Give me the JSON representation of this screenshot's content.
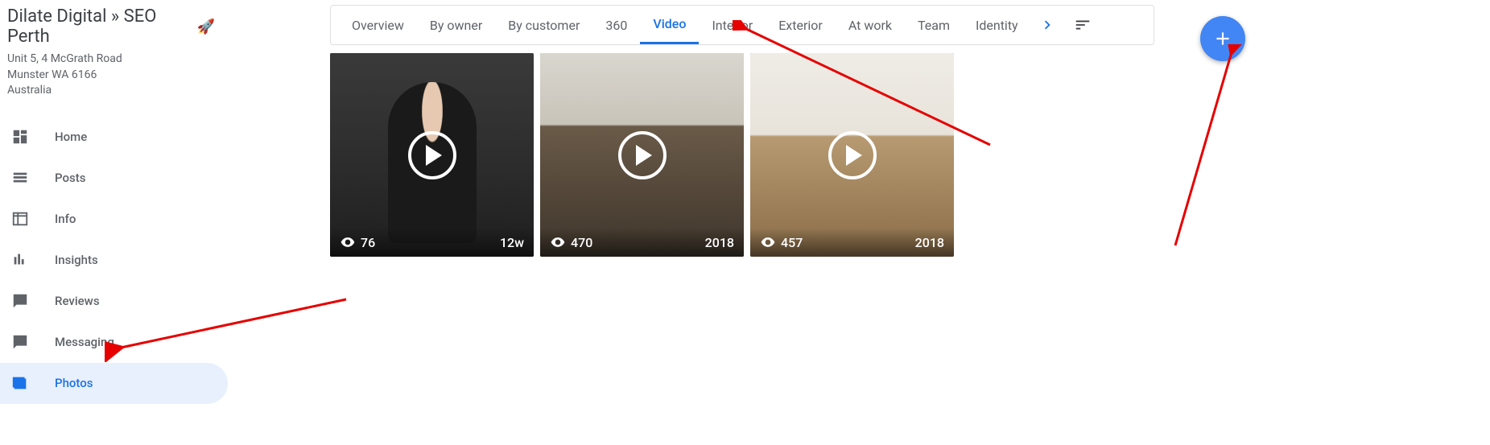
{
  "business": {
    "name": "Dilate Digital » SEO Perth",
    "rocket": "🚀",
    "address1": "Unit 5, 4 McGrath Road",
    "address2": "Munster WA 6166",
    "country": "Australia"
  },
  "sidebar": {
    "items": [
      {
        "label": "Home"
      },
      {
        "label": "Posts"
      },
      {
        "label": "Info"
      },
      {
        "label": "Insights"
      },
      {
        "label": "Reviews"
      },
      {
        "label": "Messaging"
      },
      {
        "label": "Photos"
      }
    ]
  },
  "tabs": {
    "items": [
      {
        "label": "Overview"
      },
      {
        "label": "By owner"
      },
      {
        "label": "By customer"
      },
      {
        "label": "360"
      },
      {
        "label": "Video"
      },
      {
        "label": "Interior"
      },
      {
        "label": "Exterior"
      },
      {
        "label": "At work"
      },
      {
        "label": "Team"
      },
      {
        "label": "Identity"
      }
    ],
    "active": "Video"
  },
  "videos": [
    {
      "views": "76",
      "date": "12w"
    },
    {
      "views": "470",
      "date": "2018"
    },
    {
      "views": "457",
      "date": "2018"
    }
  ]
}
